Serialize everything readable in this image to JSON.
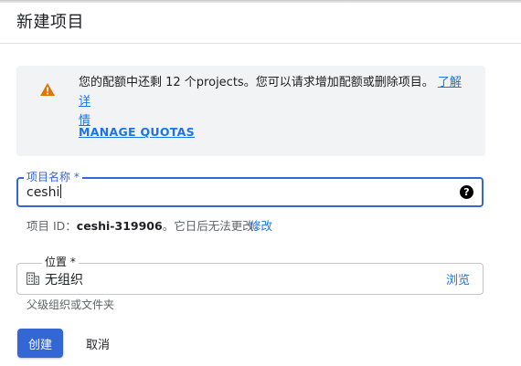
{
  "dialog": {
    "title": "新建项目"
  },
  "quota_banner": {
    "icon": "warning-icon",
    "message": "您的配额中还剩 12 个projects。您可以请求增加配额或删除项目。",
    "learn_more_part1": "了解详",
    "learn_more_part2": "情",
    "manage_quotas": "MANAGE QUOTAS",
    "icon_color": "#e37400"
  },
  "project_name": {
    "label": "项目名称 *",
    "value": "ceshi",
    "help_icon": "help-icon"
  },
  "project_id": {
    "prefix": "项目 ID：",
    "value": "ceshi-319906",
    "suffix": "。它日后无法更改。",
    "edit_label": "修改"
  },
  "location": {
    "label": "位置 *",
    "icon": "organization-icon",
    "value": "无组织",
    "browse_label": "浏览",
    "hint": "父级组织或文件夹"
  },
  "actions": {
    "create_label": "创建",
    "cancel_label": "取消"
  },
  "colors": {
    "accent": "#3367d6",
    "link": "#1a73e8",
    "banner_bg": "#f1f3f4"
  }
}
